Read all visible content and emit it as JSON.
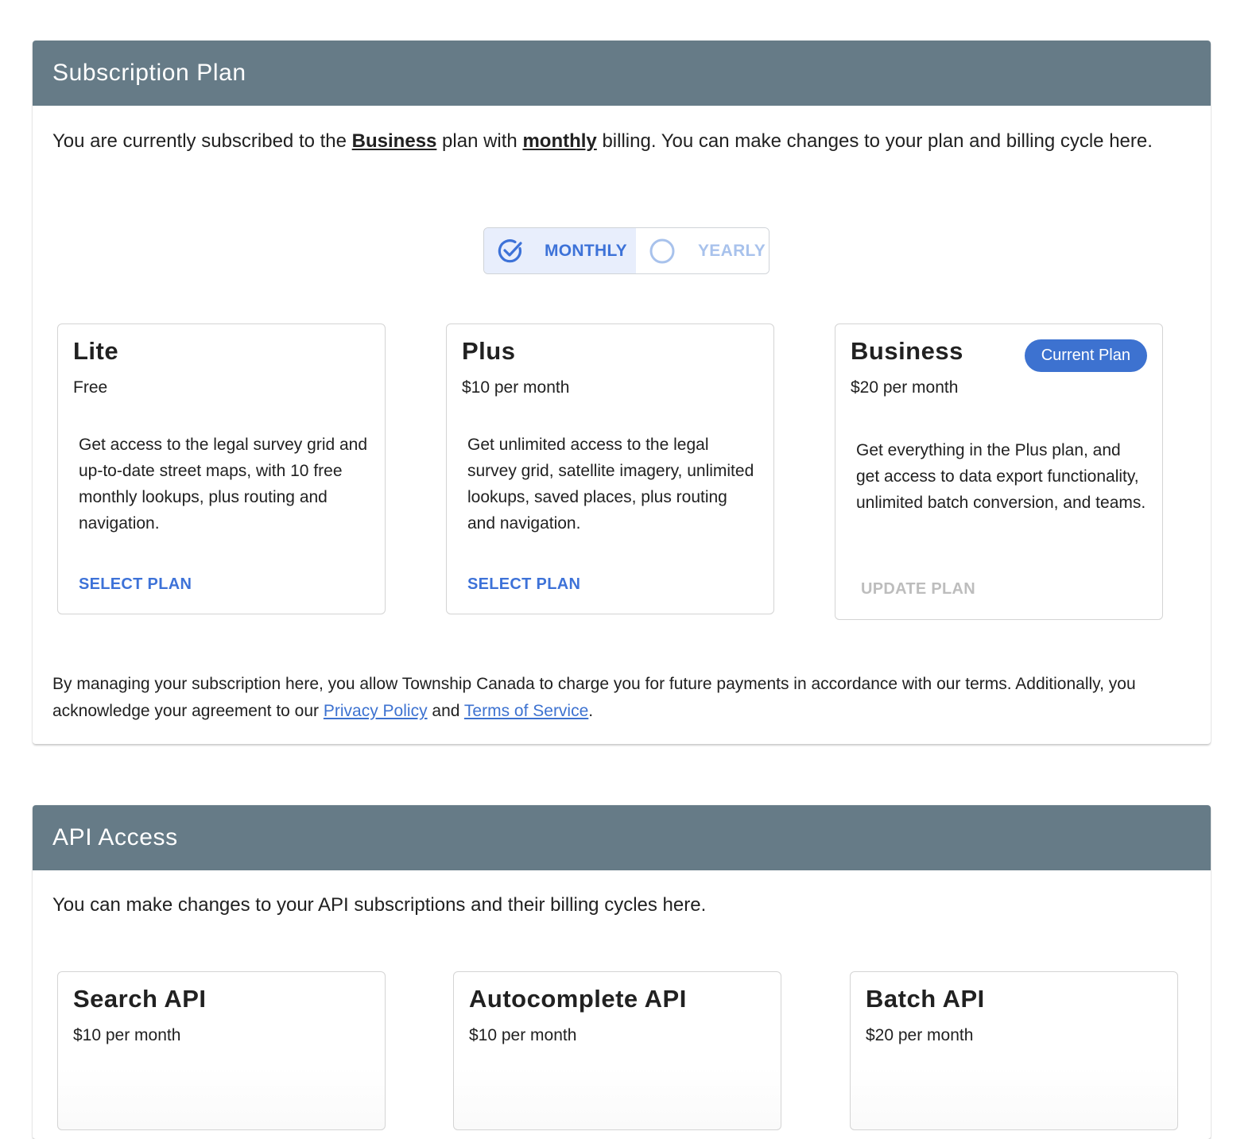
{
  "subscription": {
    "title": "Subscription Plan",
    "intro": {
      "prefix": "You are currently subscribed to the ",
      "plan": "Business",
      "middle": " plan with ",
      "cycle": "monthly",
      "suffix": " billing. You can make changes to your plan and billing cycle here."
    },
    "billing_toggle": {
      "options": [
        {
          "label": "MONTHLY",
          "selected": true,
          "icon": "check-circle-icon"
        },
        {
          "label": "YEARLY",
          "selected": false,
          "icon": "radio-circle-icon"
        }
      ]
    },
    "plans": [
      {
        "name": "Lite",
        "price": "Free",
        "description": "Get access to the legal survey grid and up-to-date street maps, with 10 free monthly lookups, plus routing and navigation.",
        "action": "SELECT PLAN",
        "current": false
      },
      {
        "name": "Plus",
        "price": "$10 per month",
        "description": "Get unlimited access to the legal survey grid, satellite imagery, unlimited lookups, saved places, plus routing and navigation.",
        "action": "SELECT PLAN",
        "current": false
      },
      {
        "name": "Business",
        "price": "$20 per month",
        "description": "Get everything in the Plus plan, and get access to data export functionality, unlimited batch conversion, and teams.",
        "action": "UPDATE PLAN",
        "current": true,
        "badge": "Current Plan"
      }
    ],
    "footnote": {
      "text_before": "By managing your subscription here, you allow Township Canada to charge you for future payments in accordance with our terms. Additionally, you acknowledge your agreement to our ",
      "privacy_link": "Privacy Policy",
      "between": " and ",
      "terms_link": "Terms of Service",
      "end": "."
    }
  },
  "api_access": {
    "title": "API Access",
    "intro": "You can make changes to your API subscriptions and their billing cycles here.",
    "apis": [
      {
        "name": "Search API",
        "price": "$10 per month"
      },
      {
        "name": "Autocomplete API",
        "price": "$10 per month"
      },
      {
        "name": "Batch API",
        "price": "$20 per month"
      }
    ]
  },
  "colors": {
    "header_bg": "#667b87",
    "accent": "#3d72d8",
    "toggle_active_bg": "#e8eefc",
    "disabled_text": "#bdbdbd"
  }
}
